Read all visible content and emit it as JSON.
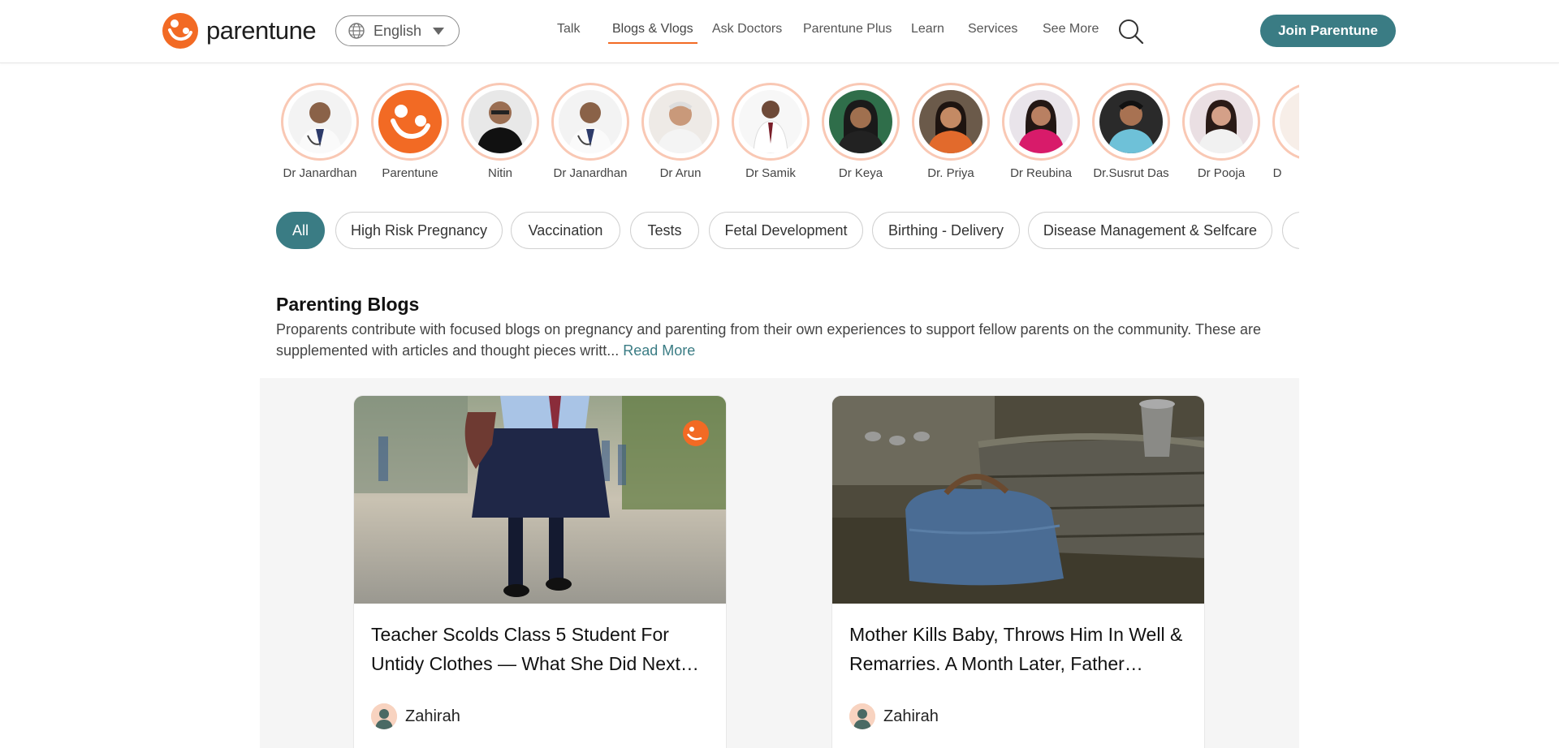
{
  "brand": {
    "name": "parentune",
    "accent": "#f26a24",
    "teal": "#3a7c84"
  },
  "header": {
    "language": "English",
    "nav": [
      {
        "label": "Talk",
        "active": false
      },
      {
        "label": "Blogs & Vlogs",
        "active": true
      },
      {
        "label": "Ask Doctors",
        "active": false
      },
      {
        "label": "Parentune Plus",
        "active": false
      },
      {
        "label": "Learn",
        "active": false
      },
      {
        "label": "Services",
        "active": false
      },
      {
        "label": "See More",
        "active": false
      }
    ],
    "search_icon": "search-icon",
    "join_label": "Join Parentune"
  },
  "experts": [
    {
      "name": "Dr Janardhan"
    },
    {
      "name": "Parentune"
    },
    {
      "name": "Nitin"
    },
    {
      "name": "Dr Janardhan"
    },
    {
      "name": "Dr Arun"
    },
    {
      "name": "Dr Samik"
    },
    {
      "name": "Dr Keya"
    },
    {
      "name": "Dr. Priya"
    },
    {
      "name": "Dr Reubina"
    },
    {
      "name": "Dr.Susrut Das"
    },
    {
      "name": "Dr Pooja"
    },
    {
      "name": "D"
    }
  ],
  "categories": [
    {
      "label": "All",
      "active": true
    },
    {
      "label": "High Risk Pregnancy",
      "active": false
    },
    {
      "label": "Vaccination",
      "active": false
    },
    {
      "label": "Tests",
      "active": false
    },
    {
      "label": "Fetal Development",
      "active": false
    },
    {
      "label": "Birthing - Delivery",
      "active": false
    },
    {
      "label": "Disease Management & Selfcare",
      "active": false
    },
    {
      "label": "",
      "active": false
    }
  ],
  "blogs": {
    "title": "Parenting Blogs",
    "description": "Proparents contribute with focused blogs on pregnancy and parenting from their own experiences to support fellow parents on the community. These are supplemented with articles and thought pieces writt...",
    "read_more": "Read More",
    "cards": [
      {
        "title": "Teacher Scolds Class 5 Student For Untidy Clothes — What She Did Next…",
        "author": "Zahirah"
      },
      {
        "title": "Mother Kills Baby, Throws Him In Well & Remarries. A Month Later, Father…",
        "author": "Zahirah"
      }
    ]
  }
}
